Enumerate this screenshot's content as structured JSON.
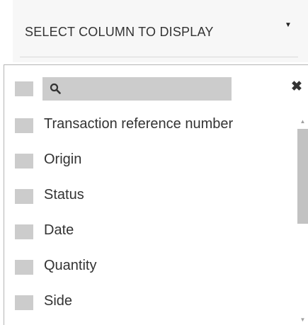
{
  "header": {
    "title": "SELECT COLUMN TO DISPLAY",
    "caret": "▼"
  },
  "search": {
    "icon": "search-icon",
    "clear_symbol": "✖",
    "value": ""
  },
  "columns": [
    {
      "label": "Transaction reference number",
      "checked": false
    },
    {
      "label": "Origin",
      "checked": false
    },
    {
      "label": "Status",
      "checked": false
    },
    {
      "label": "Date",
      "checked": false
    },
    {
      "label": "Quantity",
      "checked": false
    },
    {
      "label": "Side",
      "checked": false
    }
  ],
  "scrollbar": {
    "up_arrow": "▲",
    "down_arrow": "▼"
  },
  "colors": {
    "header_bg": "#f7f7f7",
    "checkbox_bg": "#cccccc",
    "search_bg": "#cccccc",
    "text": "#333333",
    "scroll_thumb": "#c2c2c2"
  }
}
